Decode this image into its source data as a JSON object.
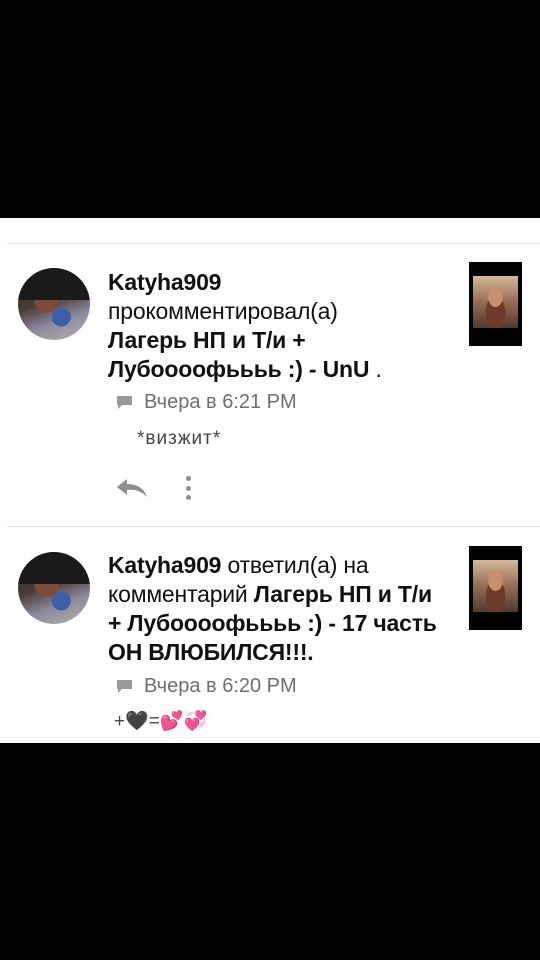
{
  "notifications": [
    {
      "username": "Katyha909",
      "action": "прокомментировал(а)",
      "title": "Лагерь НП и Т/и + Лубоооофьььь :) - UnU",
      "title_suffix": ".",
      "timestamp": "Вчера в 6:21 PM",
      "comment": "*визжит*"
    },
    {
      "username": "Katyha909",
      "action": "ответил(а) на комментарий",
      "title": "Лагерь НП и Т/и + Лубоооофьььь :) - 17 часть ОН ВЛЮБИЛСЯ!!!.",
      "timestamp": "Вчера в 6:20 PM",
      "comment": "+🖤=💕💞"
    }
  ],
  "icons": {
    "comment": "comment-bubble-icon",
    "reply": "reply-arrow-icon",
    "more": "more-vertical-icon"
  },
  "colors": {
    "background": "#000000",
    "panel": "#ffffff",
    "meta_text": "#6f6f6f",
    "icon_gray": "#8e8e8e"
  }
}
